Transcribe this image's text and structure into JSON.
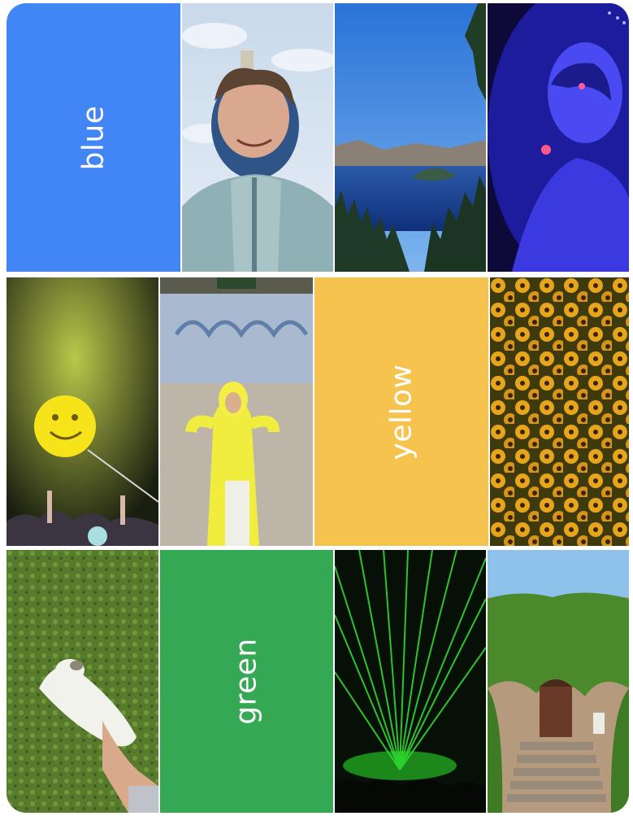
{
  "rows": [
    {
      "color_name": "blue",
      "label_color": "#4285f4"
    },
    {
      "color_name": "yellow",
      "label_color": "#f5c34e"
    },
    {
      "color_name": "green",
      "label_color": "#35a853"
    }
  ],
  "photos": [
    "selfie-in-raincoat-under-sky",
    "crater-lake-with-island",
    "person-in-blue-concert-light",
    "smiley-balloon-at-concert",
    "person-in-yellow-raincoat",
    "field-of-yellow-flowers",
    "cat-lying-in-grass",
    "green-laser-light-show",
    "ivy-covered-brownstone"
  ]
}
